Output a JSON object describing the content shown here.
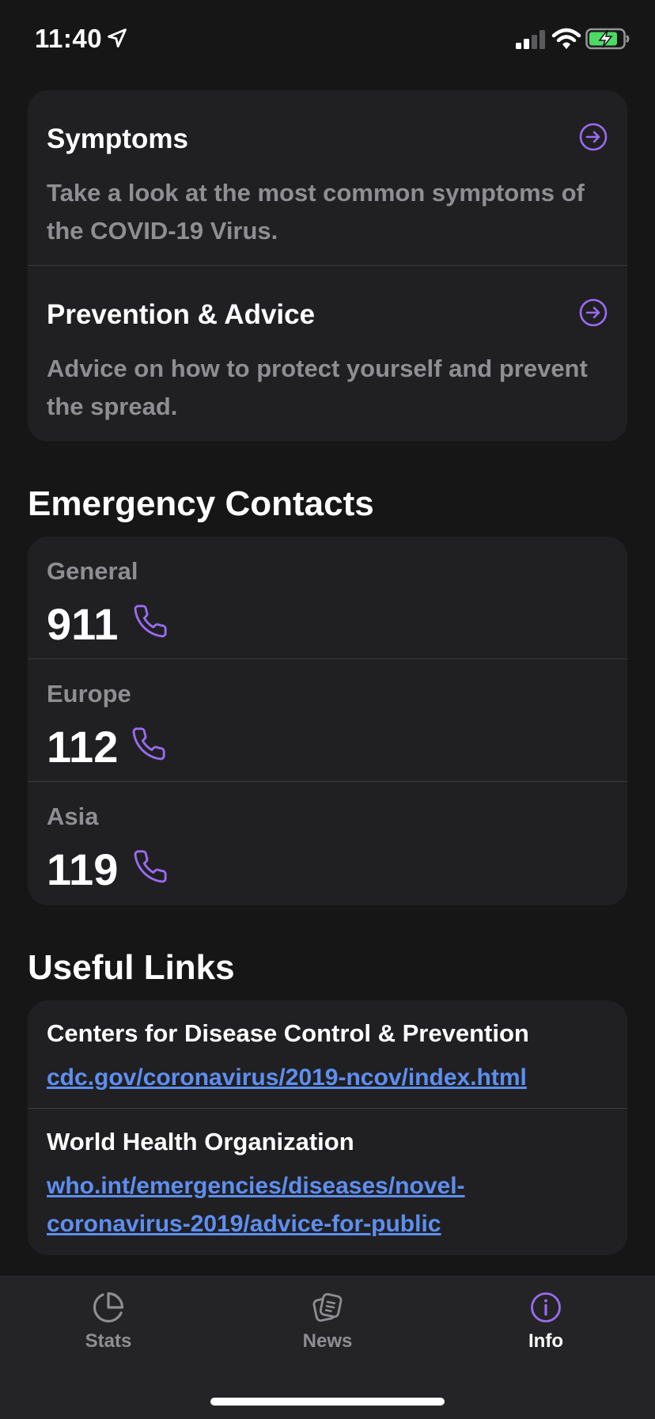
{
  "status": {
    "time": "11:40"
  },
  "info_cards": [
    {
      "title": "Symptoms",
      "description": "Take a look at the most common symptoms of the COVID-19 Virus."
    },
    {
      "title": "Prevention & Advice",
      "description": "Advice on how to protect yourself and prevent the spread."
    }
  ],
  "emergency": {
    "title": "Emergency Contacts",
    "contacts": [
      {
        "label": "General",
        "number": "911"
      },
      {
        "label": "Europe",
        "number": "112"
      },
      {
        "label": "Asia",
        "number": "119"
      }
    ]
  },
  "links": {
    "title": "Useful Links",
    "items": [
      {
        "name": "Centers for Disease Control & Prevention",
        "url": "cdc.gov/coronavirus/2019-ncov/index.html"
      },
      {
        "name": "World Health Organization",
        "url": "who.int/emergencies/diseases/novel-coronavirus-2019/advice-for-public"
      }
    ]
  },
  "tabs": [
    {
      "label": "Stats",
      "icon": "pie-chart-icon"
    },
    {
      "label": "News",
      "icon": "news-icon"
    },
    {
      "label": "Info",
      "icon": "info-icon",
      "active": true
    }
  ],
  "colors": {
    "accent": "#9a6cf0",
    "link": "#5e8ef0",
    "background": "#161617",
    "card": "#202022"
  }
}
